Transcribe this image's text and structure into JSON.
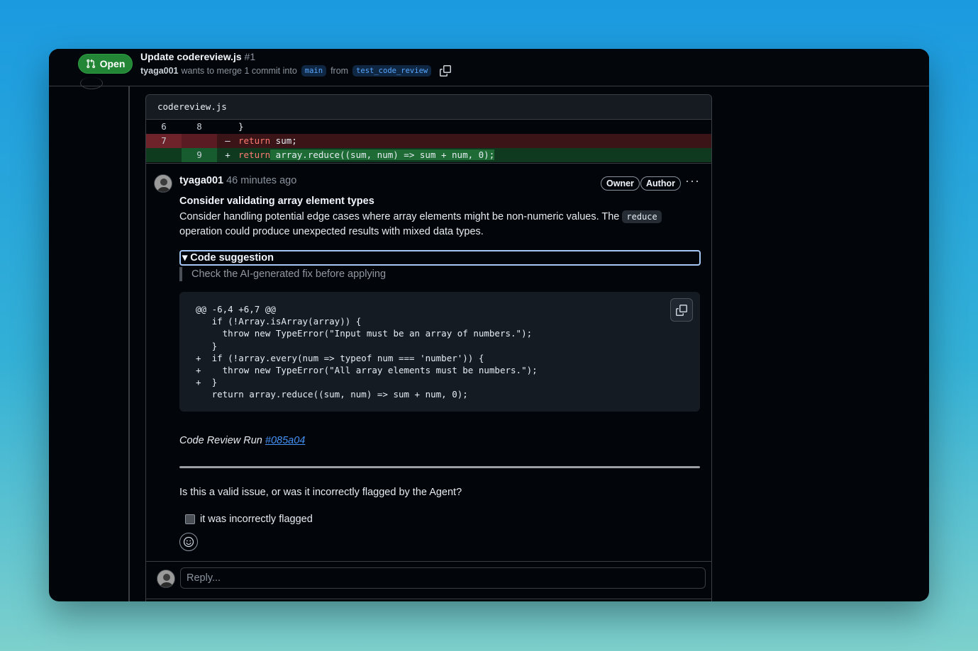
{
  "header": {
    "status": "Open",
    "title": "Update codereview.js",
    "number": "#1",
    "author": "tyaga001",
    "merge_text": "wants to merge 1 commit into",
    "base_branch": "main",
    "from_text": "from",
    "head_branch": "test_code_review",
    "status_color": "#238636"
  },
  "diff": {
    "filename": "codereview.js",
    "rows": [
      {
        "old": "6",
        "new": "8",
        "sign": "",
        "code": "}"
      },
      {
        "old": "7",
        "new": "",
        "sign": "–",
        "code_kw": "return",
        "code_rest": " sum;"
      },
      {
        "old": "",
        "new": "9",
        "sign": "+",
        "code_kw": "return",
        "code_rest": " array.reduce((sum, num) => sum + num, 0);"
      }
    ]
  },
  "comment": {
    "author": "tyaga001",
    "time": "46 minutes ago",
    "badges": [
      "Owner",
      "Author"
    ],
    "more": "···",
    "title": "Consider validating array element types",
    "body_before": "Consider handling potential edge cases where array elements might be non-numeric values. The ",
    "body_code": "reduce",
    "body_after": " operation could produce unexpected results with mixed data types.",
    "summary": "▾ Code suggestion",
    "quote": "Check the AI-generated fix before applying",
    "suggestion": "@@ -6,4 +6,7 @@\n   if (!Array.isArray(array)) {\n     throw new TypeError(\"Input must be an array of numbers.\");\n   }\n+  if (!array.every(num => typeof num === 'number')) {\n+    throw new TypeError(\"All array elements must be numbers.\");\n+  }\n   return array.reduce((sum, num) => sum + num, 0);",
    "run_label": "Code Review Run ",
    "run_link": "#085a04",
    "question": "Is this a valid issue, or was it incorrectly flagged by the Agent?",
    "checkbox_label": "it was incorrectly flagged"
  },
  "reply": {
    "placeholder": "Reply..."
  }
}
